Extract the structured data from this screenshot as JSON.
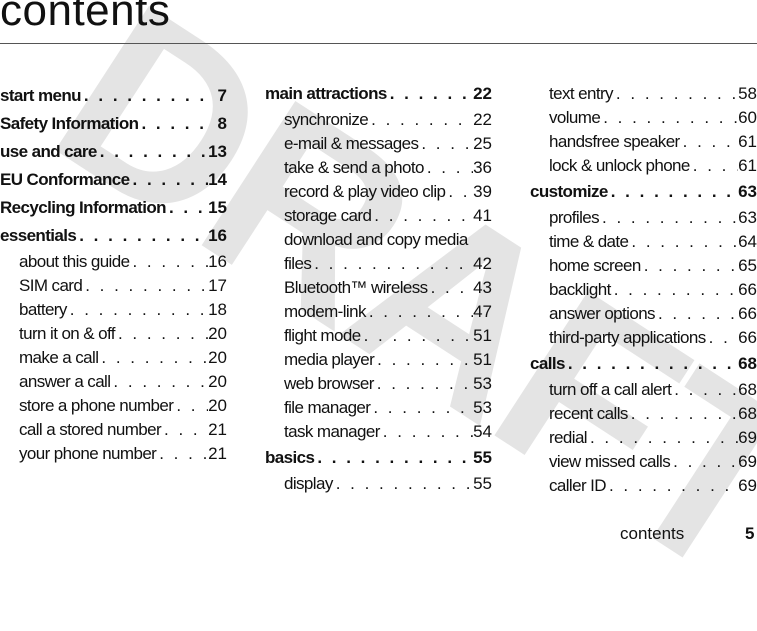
{
  "watermark": "DRAFT",
  "title": "contents",
  "columns": [
    [
      {
        "label": "start menu",
        "page": "7",
        "level": "main"
      },
      {
        "label": "Safety Information",
        "page": "8",
        "level": "main"
      },
      {
        "label": "use and care",
        "page": "13",
        "level": "main"
      },
      {
        "label": "EU Conformance",
        "page": "14",
        "level": "main"
      },
      {
        "label": "Recycling Information",
        "page": "15",
        "level": "main"
      },
      {
        "label": "essentials",
        "page": "16",
        "level": "main"
      },
      {
        "label": "about this guide",
        "page": "16",
        "level": "sub"
      },
      {
        "label": "SIM card",
        "page": "17",
        "level": "sub"
      },
      {
        "label": "battery",
        "page": "18",
        "level": "sub"
      },
      {
        "label": "turn it on & off",
        "page": "20",
        "level": "sub"
      },
      {
        "label": "make a call",
        "page": "20",
        "level": "sub"
      },
      {
        "label": "answer a call",
        "page": "20",
        "level": "sub"
      },
      {
        "label": "store a phone number",
        "page": "20",
        "level": "sub"
      },
      {
        "label": "call a stored number",
        "page": "21",
        "level": "sub"
      },
      {
        "label": "your phone number",
        "page": "21",
        "level": "sub"
      }
    ],
    [
      {
        "label": "main attractions",
        "page": "22",
        "level": "main"
      },
      {
        "label": "synchronize",
        "page": "22",
        "level": "sub"
      },
      {
        "label": "e-mail & messages",
        "page": "25",
        "level": "sub"
      },
      {
        "label": "take & send a photo",
        "page": "36",
        "level": "sub"
      },
      {
        "label": "record & play video clip",
        "page": "39",
        "level": "sub"
      },
      {
        "label": "storage card",
        "page": "41",
        "level": "sub"
      },
      {
        "label": "download and copy media",
        "level": "cont"
      },
      {
        "label": "files",
        "page": "42",
        "level": "sub"
      },
      {
        "label": "Bluetooth™ wireless",
        "page": "43",
        "level": "sub"
      },
      {
        "label": "modem-link",
        "page": "47",
        "level": "sub"
      },
      {
        "label": "flight mode",
        "page": "51",
        "level": "sub"
      },
      {
        "label": "media player",
        "page": "51",
        "level": "sub"
      },
      {
        "label": "web browser",
        "page": "53",
        "level": "sub"
      },
      {
        "label": "file manager",
        "page": "53",
        "level": "sub"
      },
      {
        "label": "task manager",
        "page": "54",
        "level": "sub"
      },
      {
        "label": "basics",
        "page": "55",
        "level": "main"
      },
      {
        "label": "display",
        "page": "55",
        "level": "sub"
      }
    ],
    [
      {
        "label": "text entry",
        "page": "58",
        "level": "sub"
      },
      {
        "label": "volume",
        "page": "60",
        "level": "sub"
      },
      {
        "label": "handsfree speaker",
        "page": "61",
        "level": "sub"
      },
      {
        "label": "lock & unlock phone",
        "page": "61",
        "level": "sub"
      },
      {
        "label": "customize",
        "page": "63",
        "level": "main"
      },
      {
        "label": "profiles",
        "page": "63",
        "level": "sub"
      },
      {
        "label": "time & date",
        "page": "64",
        "level": "sub"
      },
      {
        "label": "home screen",
        "page": "65",
        "level": "sub"
      },
      {
        "label": "backlight",
        "page": "66",
        "level": "sub"
      },
      {
        "label": "answer options",
        "page": "66",
        "level": "sub"
      },
      {
        "label": "third-party applications",
        "page": "66",
        "level": "sub"
      },
      {
        "label": "calls",
        "page": "68",
        "level": "main"
      },
      {
        "label": "turn off a call alert",
        "page": "68",
        "level": "sub"
      },
      {
        "label": "recent calls",
        "page": "68",
        "level": "sub"
      },
      {
        "label": "redial",
        "page": "69",
        "level": "sub"
      },
      {
        "label": "view missed calls",
        "page": "69",
        "level": "sub"
      },
      {
        "label": "caller ID",
        "page": "69",
        "level": "sub"
      }
    ]
  ],
  "footer": {
    "section": "contents",
    "page": "5"
  }
}
